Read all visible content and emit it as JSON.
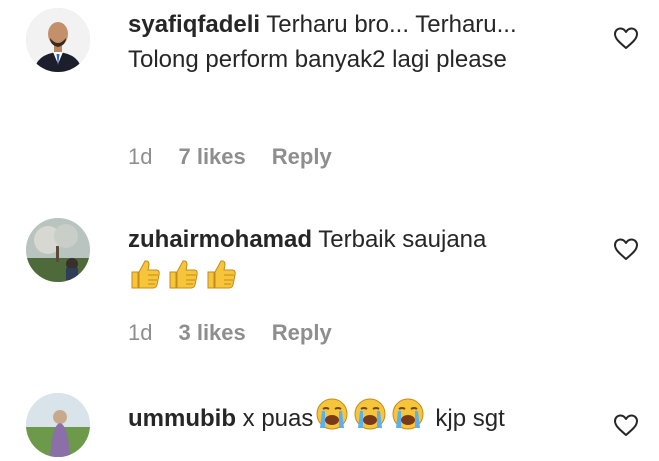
{
  "comments": [
    {
      "username": "syafiqfadeli",
      "text": " Terharu bro... Terharu... Tolong perform banyak2 lagi please",
      "time": "1d",
      "likes": "7 likes",
      "reply": "Reply",
      "avatar_icon": "profile-photo-man-in-suit",
      "like_icon": "heart-outline-icon"
    },
    {
      "username": "zuhairmohamad",
      "text": " Terbaik saujana",
      "emojis": [
        "thumbs-up",
        "thumbs-up",
        "thumbs-up"
      ],
      "time": "1d",
      "likes": "3 likes",
      "reply": "Reply",
      "avatar_icon": "profile-photo-outdoor-tree",
      "like_icon": "heart-outline-icon"
    },
    {
      "username": "ummubib",
      "text_before": " x puas",
      "emojis": [
        "loudly-crying-face",
        "loudly-crying-face",
        "loudly-crying-face"
      ],
      "text_after": "kjp sgt",
      "avatar_icon": "profile-photo-field",
      "like_icon": "heart-outline-icon"
    }
  ],
  "colors": {
    "primary_text": "#262626",
    "secondary_text": "#8e8e8e",
    "emoji_yellow": "#f7c53a"
  }
}
